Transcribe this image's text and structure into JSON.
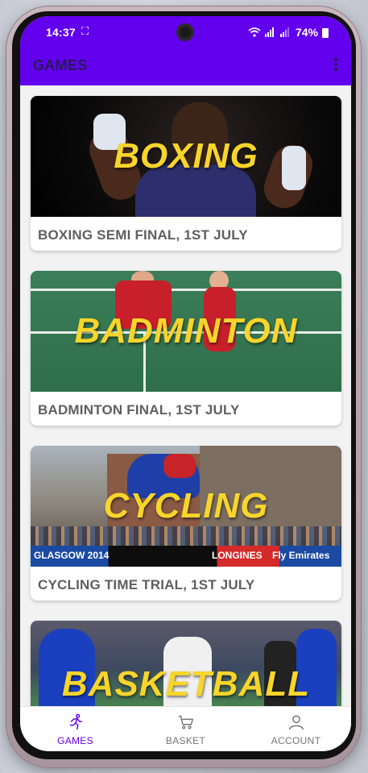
{
  "status_bar": {
    "time": "14:37",
    "battery": "74%",
    "screen_icon": "screenshot-icon"
  },
  "app_bar": {
    "title": "GAMES",
    "menu_icon": "more-vert-icon"
  },
  "games": [
    {
      "overlay": "BOXING",
      "caption": "BOXING SEMI FINAL, 1ST JULY"
    },
    {
      "overlay": "BADMINTON",
      "caption": "BADMINTON FINAL, 1ST JULY"
    },
    {
      "overlay": "CYCLING",
      "caption": "CYCLING TIME TRIAL, 1ST JULY",
      "banner": [
        "GLASGOW 2014",
        "LONGINES",
        "Fly Emirates"
      ]
    },
    {
      "overlay": "BASKETBALL",
      "caption": ""
    }
  ],
  "bottom_nav": [
    {
      "label": "GAMES",
      "icon": "running-person-icon",
      "active": true
    },
    {
      "label": "BASKET",
      "icon": "cart-icon",
      "active": false
    },
    {
      "label": "ACCOUNT",
      "icon": "person-icon",
      "active": false
    }
  ],
  "colors": {
    "primary": "#6200ee",
    "overlay_text": "#f8d52b",
    "caption_text": "#5f5f5f"
  }
}
